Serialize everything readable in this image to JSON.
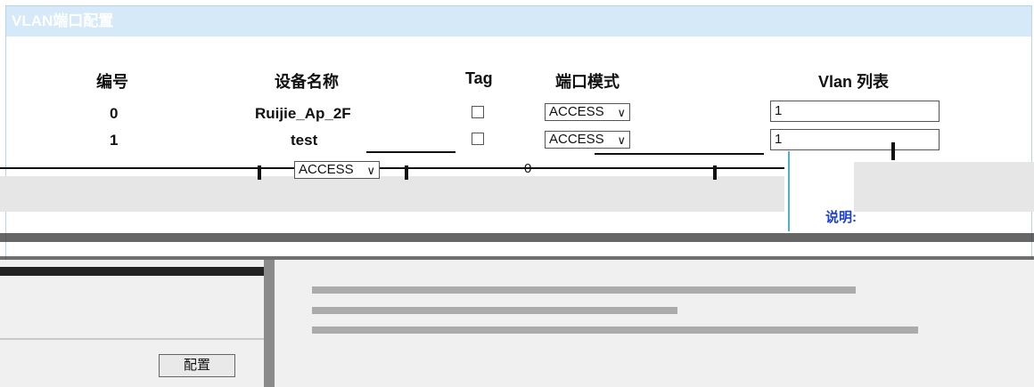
{
  "panel": {
    "title": "VLAN端口配置"
  },
  "table": {
    "headers": [
      "编号",
      "设备名称",
      "Tag",
      "端口模式",
      "Vlan 列表"
    ],
    "rows": [
      {
        "id": "0",
        "name": "Ruijie_Ap_2F",
        "mode": "ACCESS",
        "vlan": "1"
      },
      {
        "id": "1",
        "name": "test",
        "mode": "ACCESS",
        "vlan": "1"
      },
      {
        "id": "",
        "name": "",
        "mode": "ACCESS",
        "vlan": "0"
      }
    ]
  },
  "notes": {
    "title": "说明:"
  },
  "actions": {
    "config_label": "配置"
  }
}
